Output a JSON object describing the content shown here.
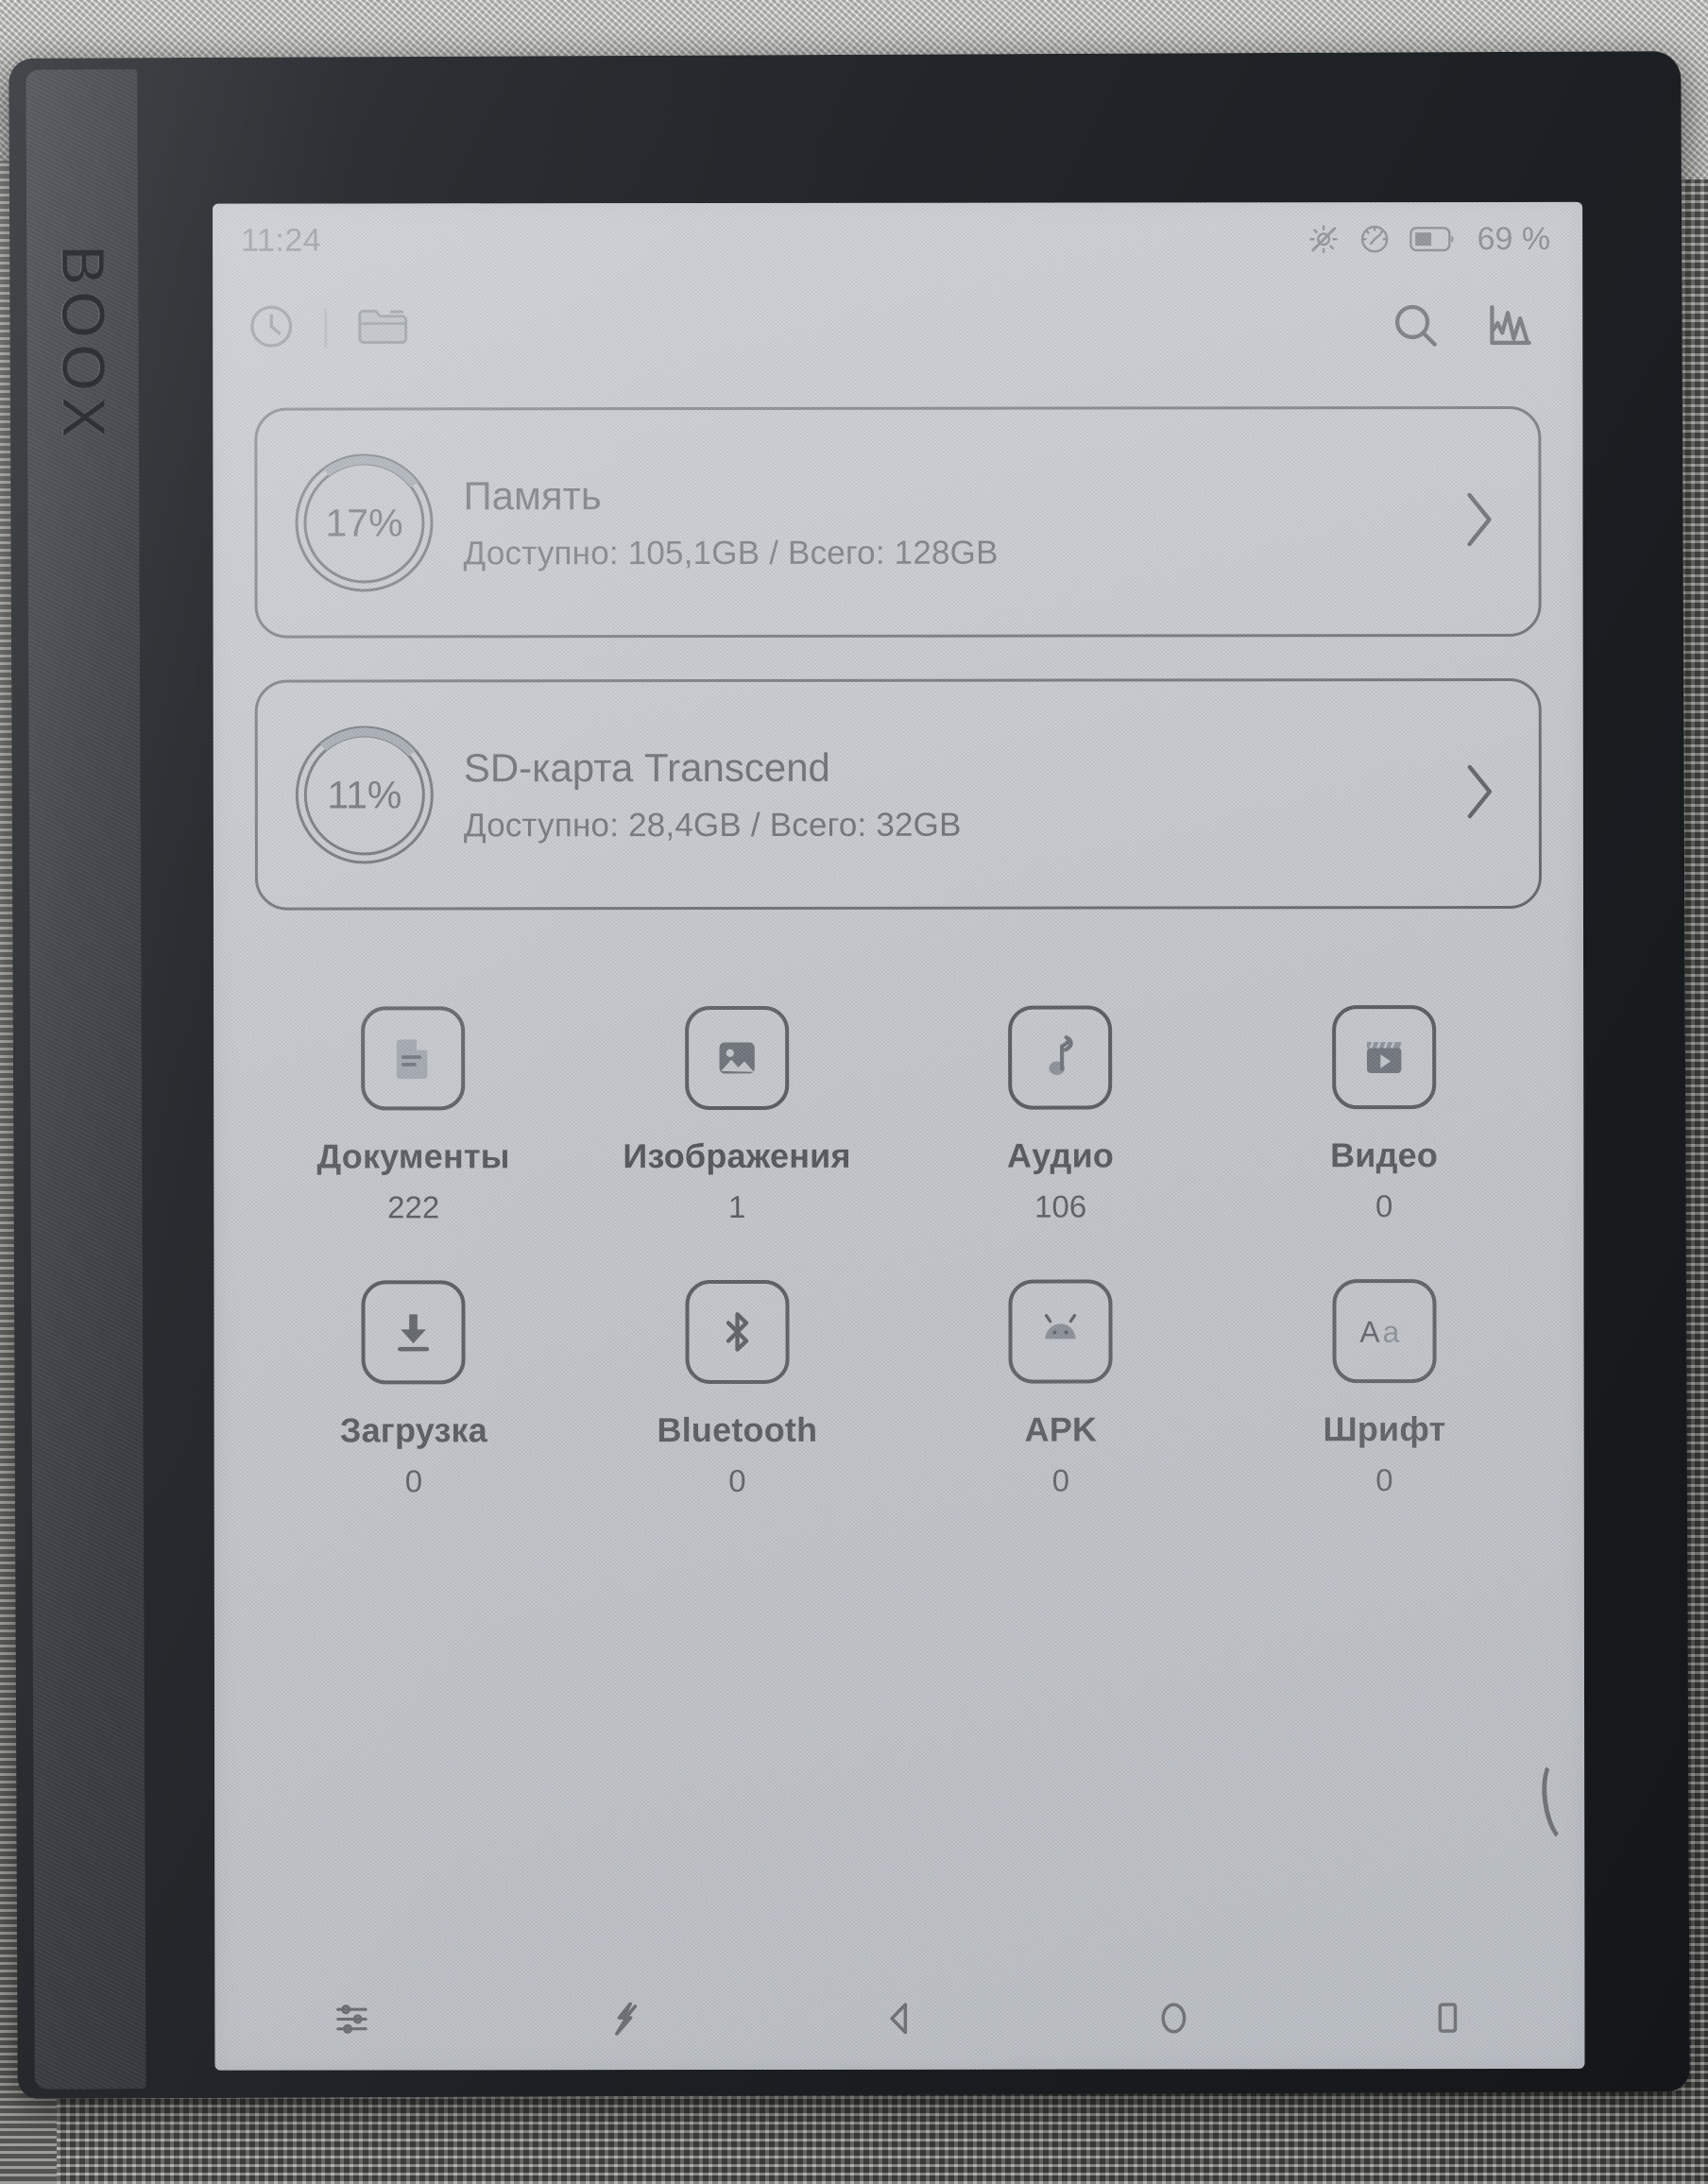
{
  "device": {
    "brand": "BOOX"
  },
  "status_bar": {
    "time": "11:24",
    "battery_percent": "69 %",
    "icons": [
      "brightness-off-icon",
      "refresh-mode-icon",
      "battery-icon"
    ]
  },
  "toolbar": {
    "left_icons": [
      "recent-clock-icon",
      "folder-icon"
    ],
    "right_icons": [
      "search-icon",
      "statistics-icon"
    ]
  },
  "storage": [
    {
      "percent_label": "17%",
      "percent": 17,
      "title": "Память",
      "subtitle": "Доступно: 105,1GB / Всего: 128GB",
      "chevron": "chevron-right-icon"
    },
    {
      "percent_label": "11%",
      "percent": 11,
      "title": "SD-карта Transcend",
      "subtitle": "Доступно: 28,4GB / Всего: 32GB",
      "chevron": "chevron-right-icon"
    }
  ],
  "categories": [
    {
      "icon": "document-icon",
      "label": "Документы",
      "count": "222"
    },
    {
      "icon": "image-icon",
      "label": "Изображения",
      "count": "1"
    },
    {
      "icon": "audio-icon",
      "label": "Аудио",
      "count": "106"
    },
    {
      "icon": "video-icon",
      "label": "Видео",
      "count": "0"
    },
    {
      "icon": "download-icon",
      "label": "Загрузка",
      "count": "0"
    },
    {
      "icon": "bluetooth-icon",
      "label": "Bluetooth",
      "count": "0"
    },
    {
      "icon": "android-icon",
      "label": "APK",
      "count": "0"
    },
    {
      "icon": "font-icon",
      "label": "Шрифт",
      "count": "0"
    }
  ],
  "nav_bar": {
    "buttons": [
      {
        "icon": "settings-sliders-icon",
        "name": "nav-settings"
      },
      {
        "icon": "refresh-icon",
        "name": "nav-refresh"
      },
      {
        "icon": "back-icon",
        "name": "nav-back"
      },
      {
        "icon": "home-icon",
        "name": "nav-home"
      },
      {
        "icon": "recents-icon",
        "name": "nav-recents"
      }
    ]
  },
  "colors": {
    "screen_bg": "#c3c6cb",
    "ink": "#1d2024",
    "bezel": "#26292d",
    "ring_arc": "#868d96"
  }
}
